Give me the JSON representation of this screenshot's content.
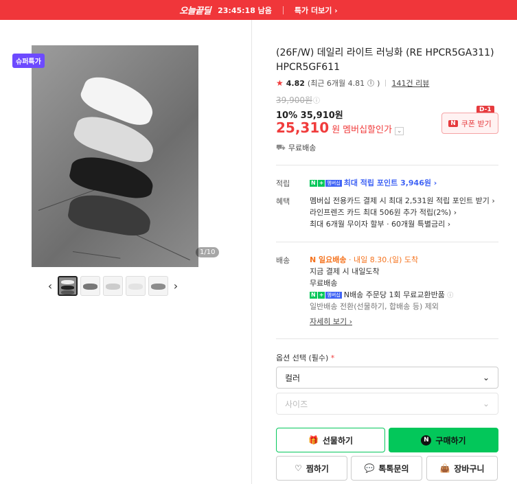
{
  "topbar": {
    "brand": "오늘끝딜",
    "timer": "23:45:18 남음",
    "more": "특가 더보기 ›"
  },
  "gallery": {
    "badge": "슈퍼특가",
    "counter": "1/10",
    "prev_icon": "‹",
    "next_icon": "›",
    "thumb_count": 5
  },
  "product": {
    "title": "(26F/W) 데일리 라이트 러닝화 (RE HPCR5GA311) HPCR5GF611",
    "rating": {
      "star": "★",
      "score": "4.82",
      "recent": "(최근 6개월 4.81",
      "recent_close": ")",
      "reviews": "141건 리뷰"
    },
    "original_price": "39,900원",
    "sale_line": "10% 35,910원",
    "member_price": "25,310",
    "won": "원",
    "member_label": "멤버십할인가",
    "coupon_label": "쿠폰 받기",
    "coupon_n": "N",
    "dday": "D-1",
    "free_shipping": "무료배송"
  },
  "benefits": {
    "point_label": "적립",
    "point_text": "최대 적립 포인트 3,946원 ›",
    "benefit_label": "혜택",
    "benefit_lines": [
      "멤버십 전용카드 결제 시 최대 2,531원 적립 포인트 받기 ›",
      "라인프렌즈 카드 최대 506원 추가 적립(2%) ›",
      "최대 6개월 무이자 할부 · 60개월 특별금리 ›"
    ]
  },
  "delivery": {
    "label": "배송",
    "tag": "N 일요배송",
    "arrival": " · 내일 8.30.(일) 도착",
    "line1": "지금 결제 시 내일도착",
    "line2": "무료배송",
    "line3": "N배송 주문당 1회 무료교환반품",
    "line4": "일반배송 전환(선물하기, 합배송 등) 제외",
    "details": "자세히 보기 ›"
  },
  "npill": {
    "n": "N",
    "plus": "+",
    "member": "멤버십"
  },
  "options": {
    "label": "옵션 선택 (필수)",
    "required_mark": "*",
    "color_select": "컬러",
    "size_select": "사이즈"
  },
  "actions": {
    "gift": "선물하기",
    "buy": "구매하기",
    "buy_n": "N",
    "wish": "찜하기",
    "talk": "톡톡문의",
    "cart": "장바구니"
  }
}
